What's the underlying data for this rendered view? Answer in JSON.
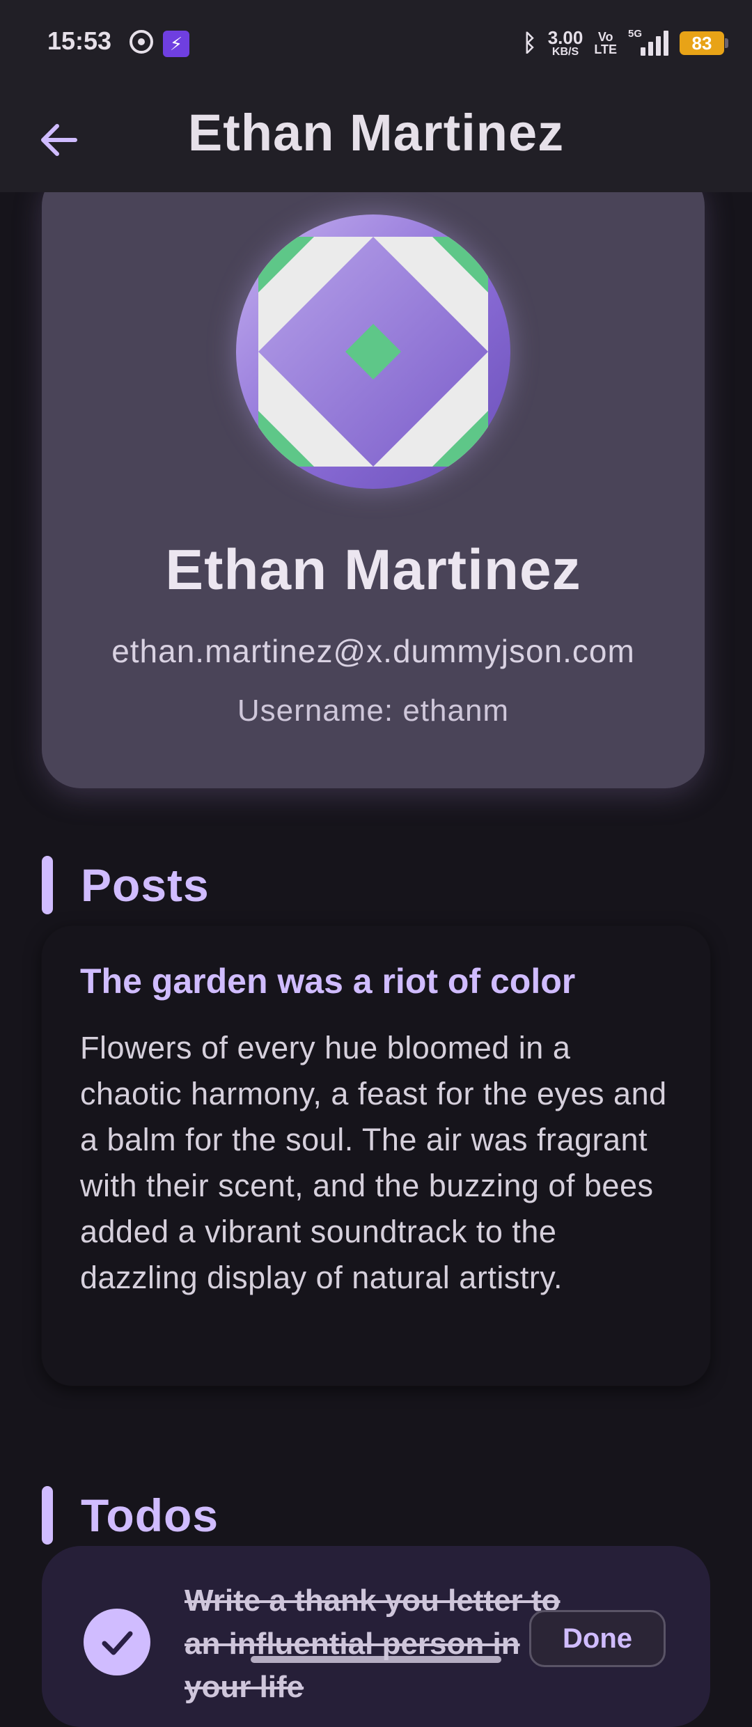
{
  "status_bar": {
    "time": "15:53",
    "net_speed_value": "3.00",
    "net_speed_unit": "KB/S",
    "volte_top": "Vo",
    "volte_bottom": "LTE",
    "network": "5G",
    "battery": "83",
    "icons": [
      "whatsapp-icon",
      "app-notification-icon",
      "bluetooth-icon",
      "signal-icon",
      "battery-icon"
    ]
  },
  "app_bar": {
    "title": "Ethan Martinez",
    "back_icon": "arrow-left-icon"
  },
  "profile": {
    "name": "Ethan Martinez",
    "email": "ethan.martinez@x.dummyjson.com",
    "username_text": "Username: ethanm"
  },
  "posts": {
    "heading": "Posts",
    "items": [
      {
        "title": "The garden was a riot of color",
        "body": "Flowers of every hue bloomed in a chaotic harmony, a feast for the eyes and a balm for the soul. The air was fragrant with their scent, and the buzzing of bees added a vibrant soundtrack to the dazzling display of natural artistry."
      }
    ]
  },
  "todos": {
    "heading": "Todos",
    "items": [
      {
        "text": "Write a thank you letter to an influential person in your life",
        "completed": true,
        "status_label": "Done"
      }
    ]
  },
  "colors": {
    "accent": "#d0bcff",
    "background": "#16141b",
    "surface": "#211f26",
    "card": "#4a4458",
    "battery": "#e8a317"
  }
}
